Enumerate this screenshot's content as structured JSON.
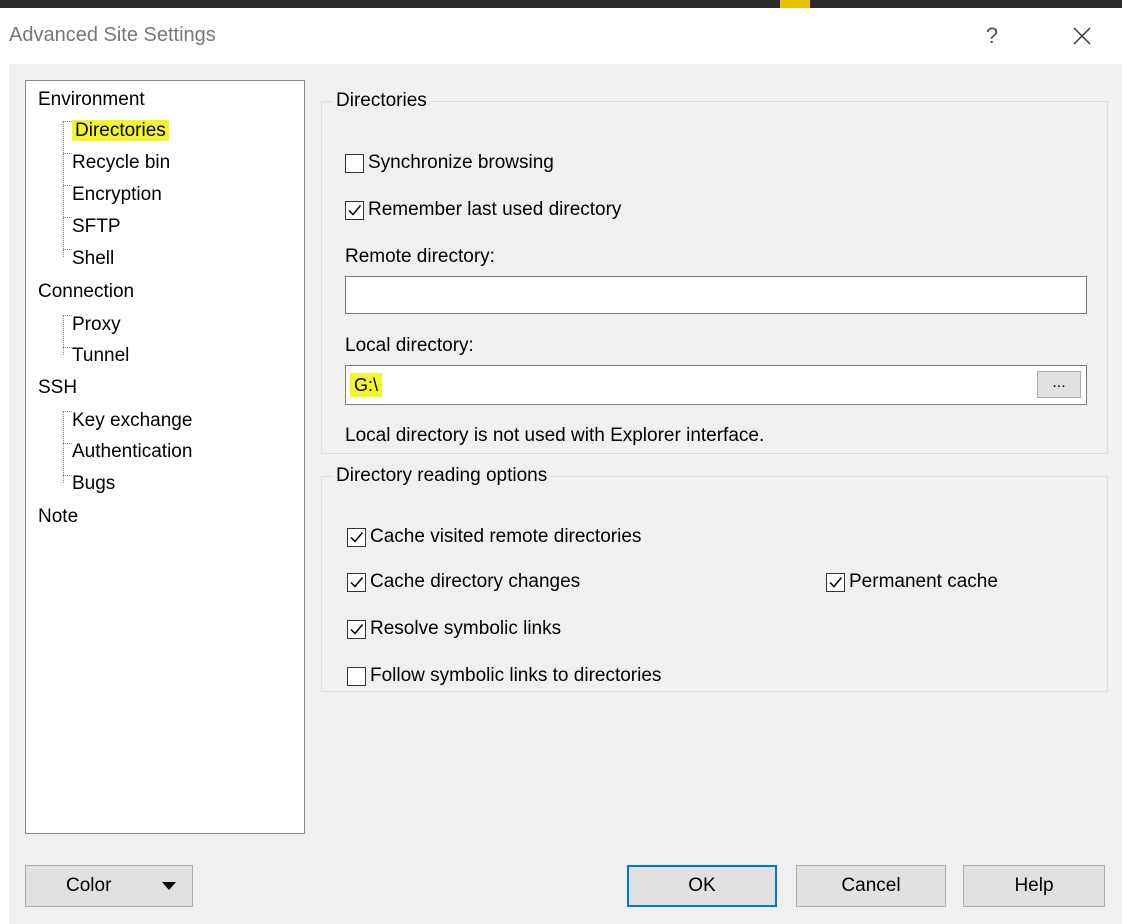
{
  "window": {
    "title": "Advanced Site Settings",
    "help_glyph": "?",
    "close_glyph": "close-icon"
  },
  "tree": {
    "environment": "Environment",
    "directories": "Directories",
    "recycle_bin": "Recycle bin",
    "encryption": "Encryption",
    "sftp": "SFTP",
    "shell": "Shell",
    "connection": "Connection",
    "proxy": "Proxy",
    "tunnel": "Tunnel",
    "ssh": "SSH",
    "key_exchange": "Key exchange",
    "authentication": "Authentication",
    "bugs": "Bugs",
    "note": "Note",
    "selected": "Directories"
  },
  "directories": {
    "legend": "Directories",
    "sync_browsing": {
      "label": "Synchronize browsing",
      "checked": false
    },
    "remember_last": {
      "label": "Remember last used directory",
      "checked": true
    },
    "remote_label": "Remote directory:",
    "remote_value": "",
    "local_label": "Local directory:",
    "local_value": "G:\\",
    "browse_label": "...",
    "note": "Local directory is not used with Explorer interface."
  },
  "reading": {
    "legend": "Directory reading options",
    "cache_visited": {
      "label": "Cache visited remote directories",
      "checked": true
    },
    "cache_changes": {
      "label": "Cache directory changes",
      "checked": true
    },
    "permanent_cache": {
      "label": "Permanent cache",
      "checked": true
    },
    "resolve_links": {
      "label": "Resolve symbolic links",
      "checked": true
    },
    "follow_links": {
      "label": "Follow symbolic links to directories",
      "checked": false
    }
  },
  "buttons": {
    "color": "Color",
    "ok": "OK",
    "cancel": "Cancel",
    "help": "Help"
  },
  "colors": {
    "highlight": "#f5f52c",
    "default_button_border": "#0078d7"
  }
}
